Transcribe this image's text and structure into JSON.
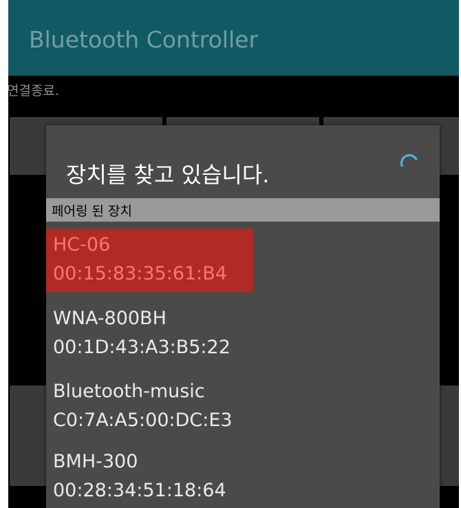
{
  "app": {
    "title": "Bluetooth Controller"
  },
  "status_text": "연결종료.",
  "dialog": {
    "title": "장치를 찾고 있습니다.",
    "section_label": "페어링 된 장치",
    "devices": [
      {
        "name": "HC-06",
        "address": "00:15:83:35:61:B4",
        "selected": true
      },
      {
        "name": "WNA-800BH",
        "address": "00:1D:43:A3:B5:22",
        "selected": false
      },
      {
        "name": "Bluetooth-music",
        "address": "C0:7A:A5:00:DC:E3",
        "selected": false
      },
      {
        "name": "BMH-300",
        "address": "00:28:34:51:18:64",
        "selected": false
      }
    ]
  },
  "colors": {
    "action_bar": "#125a63",
    "dialog_background": "#4a4a4a",
    "selected_row": "#b12b24",
    "selected_text": "#f47a6e",
    "spinner": "#4fb8ea"
  },
  "icons": {
    "progress": "loading-spinner-icon"
  }
}
